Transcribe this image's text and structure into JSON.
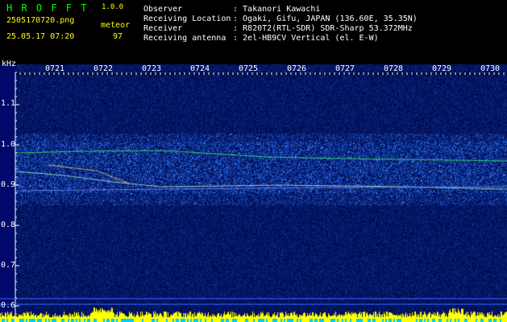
{
  "header": {
    "app_name": "H R O F F T",
    "version": "1.0.0",
    "filename": "2505170720.png",
    "label_meteor": "meteor",
    "meteor_count": "97",
    "datetime": "25.05.17 07:20"
  },
  "info": {
    "rows": [
      {
        "label": "Observer",
        "value": ": Takanori Kawachi"
      },
      {
        "label": "Receiving Location",
        "value": ": Ogaki, Gifu, JAPAN (136.60E, 35.35N)"
      },
      {
        "label": "Receiver",
        "value": ": R820T2(RTL-SDR) SDR-Sharp 53.372MHz"
      },
      {
        "label": "Receiving antenna",
        "value": ": 2el-HB9CV Vertical (el. E-W)"
      }
    ]
  },
  "axes": {
    "y_unit": "kHz",
    "y_ticks": [
      "1.1",
      "1.0",
      "0.9",
      "0.8",
      "0.7",
      "0.6"
    ],
    "x_ticks": [
      "0721",
      "0722",
      "0723",
      "0724",
      "0725",
      "0726",
      "0727",
      "0728",
      "0729",
      "0730"
    ]
  },
  "colors": {
    "background": "#000000",
    "title": "#00ff00",
    "version": "#ffff00",
    "text": "#ffffff",
    "spectrogram_base": "#00106a",
    "noise": "#2a6aff",
    "signal_line": "#40ff60",
    "bar_yellow": "#ffff00",
    "bar_cyan": "#00ccff",
    "marker_line": "#3366ff"
  }
}
